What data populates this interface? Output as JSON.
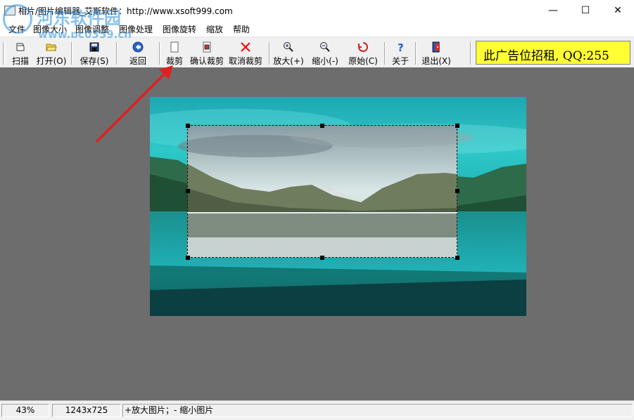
{
  "window": {
    "title": "相片/图片编辑器_艾斯软件：http://www.xsoft999.com",
    "minimize": "—",
    "maximize": "☐",
    "close": "✕"
  },
  "watermark": {
    "name": "河东软件园",
    "url": "www.pc0359.cn"
  },
  "menu": [
    "文件",
    "图像大小",
    "图像调整",
    "图像处理",
    "图像旋转",
    "缩放",
    "帮助"
  ],
  "toolbar": {
    "buttons": [
      {
        "label": "扫描",
        "icon": "scanner-icon"
      },
      {
        "label": "打开(O)",
        "icon": "folder-open-icon"
      },
      {
        "label": "保存(S)",
        "icon": "floppy-disk-icon"
      },
      {
        "label": "返回",
        "icon": "back-arrow-icon"
      },
      {
        "label": "裁剪",
        "icon": "crop-page-icon"
      },
      {
        "label": "确认裁剪",
        "icon": "crop-confirm-icon"
      },
      {
        "label": "取消裁剪",
        "icon": "red-x-icon"
      },
      {
        "label": "放大(+)",
        "icon": "zoom-in-icon"
      },
      {
        "label": "缩小(-)",
        "icon": "zoom-out-icon"
      },
      {
        "label": "原始(C)",
        "icon": "restore-original-icon"
      },
      {
        "label": "关于",
        "icon": "help-question-icon"
      },
      {
        "label": "退出(X)",
        "icon": "exit-door-icon"
      }
    ],
    "ad_text": "此广告位招租, QQ:255"
  },
  "status": {
    "zoom": "43%",
    "dimensions": "1243x725",
    "hint": "+放大图片；- 缩小图片"
  },
  "colors": {
    "canvas_bg": "#6d6d6d",
    "ad_bg": "#ffff33",
    "arrow": "#e02020"
  }
}
